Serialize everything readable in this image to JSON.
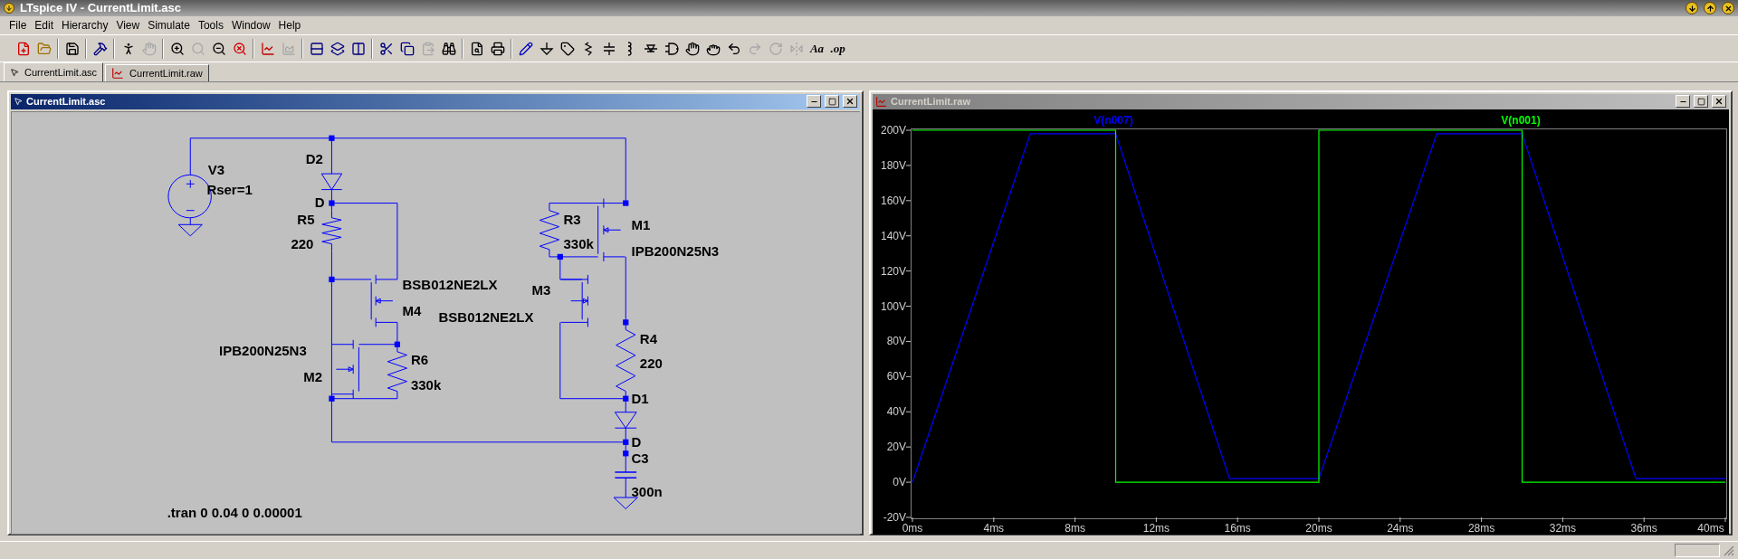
{
  "window": {
    "title": "LTspice IV - CurrentLimit.asc"
  },
  "menu": [
    "File",
    "Edit",
    "Hierarchy",
    "View",
    "Simulate",
    "Tools",
    "Window",
    "Help"
  ],
  "toolbar": [
    {
      "kind": "icon",
      "disabled": false
    },
    {
      "kind": "icon",
      "disabled": false
    },
    {
      "kind": "icon",
      "disabled": false
    },
    {
      "kind": "icon",
      "disabled": false
    },
    {
      "kind": "icon",
      "disabled": false
    },
    {
      "kind": "icon",
      "disabled": true
    },
    {
      "kind": "icon",
      "disabled": false
    },
    {
      "kind": "icon",
      "disabled": true
    },
    {
      "kind": "icon",
      "disabled": false
    },
    {
      "kind": "icon",
      "disabled": false
    },
    {
      "kind": "icon",
      "disabled": false
    },
    {
      "kind": "icon",
      "disabled": true
    },
    {
      "kind": "icon",
      "disabled": false
    },
    {
      "kind": "icon",
      "disabled": false
    },
    {
      "kind": "icon",
      "disabled": false
    },
    {
      "kind": "icon",
      "disabled": false
    },
    {
      "kind": "icon",
      "disabled": false
    },
    {
      "kind": "icon",
      "disabled": true
    },
    {
      "kind": "icon",
      "disabled": false
    },
    {
      "kind": "icon",
      "disabled": false
    },
    {
      "kind": "icon",
      "disabled": false
    },
    {
      "kind": "icon",
      "disabled": false
    },
    {
      "kind": "icon",
      "disabled": false
    },
    {
      "kind": "icon",
      "disabled": false
    },
    {
      "kind": "icon",
      "disabled": false
    },
    {
      "kind": "icon",
      "disabled": false
    },
    {
      "kind": "icon",
      "disabled": false
    },
    {
      "kind": "icon",
      "disabled": false
    },
    {
      "kind": "icon",
      "disabled": false
    },
    {
      "kind": "icon",
      "disabled": false
    },
    {
      "kind": "icon",
      "disabled": false
    },
    {
      "kind": "icon",
      "disabled": false
    },
    {
      "kind": "icon",
      "disabled": true
    },
    {
      "kind": "icon",
      "disabled": true
    },
    {
      "kind": "icon",
      "disabled": true
    },
    {
      "kind": "text",
      "label": "Aa",
      "disabled": false
    },
    {
      "kind": "text",
      "label": ".op",
      "disabled": false
    }
  ],
  "tabs": [
    {
      "label": "CurrentLimit.asc",
      "kind": "schematic",
      "selected": true
    },
    {
      "label": "CurrentLimit.raw",
      "kind": "waveform",
      "selected": false
    }
  ],
  "schematic_window": {
    "title": "CurrentLimit.asc",
    "active": true,
    "labels": [
      "V3",
      "Rser=1",
      "D2",
      "D",
      "R5",
      "220",
      "BSB012NE2LX",
      "M4",
      "IPB200N25N3",
      "M2",
      "R6",
      "330k",
      "R3",
      "330k",
      "M1",
      "IPB200N25N3",
      "M3",
      "BSB012NE2LX",
      "R4",
      "220",
      "D1",
      "D",
      "C3",
      "300n"
    ],
    "directive": ".tran 0 0.04 0 0.00001"
  },
  "plot_window": {
    "title": "CurrentLimit.raw",
    "active": false,
    "chart_data": {
      "type": "line",
      "x": [
        0,
        0,
        5.8,
        10,
        10,
        15.6,
        20,
        20,
        25.8,
        30,
        30,
        35.6,
        40
      ],
      "series": [
        {
          "name": "V(n007)",
          "color": "#0000ff",
          "values": [
            0,
            0,
            198,
            198,
            198,
            2,
            2,
            2,
            198,
            198,
            198,
            2,
            2
          ]
        },
        {
          "name": "V(n001)",
          "color": "#00ff00",
          "values": [
            null,
            200,
            null,
            200,
            0,
            0,
            0,
            200,
            null,
            200,
            0,
            0,
            0
          ]
        }
      ],
      "xlim": [
        0,
        40
      ],
      "ylim": [
        -20,
        200
      ],
      "xticks": [
        {
          "value": 0,
          "label": "0ms"
        },
        {
          "value": 4,
          "label": "4ms"
        },
        {
          "value": 8,
          "label": "8ms"
        },
        {
          "value": 12,
          "label": "12ms"
        },
        {
          "value": 16,
          "label": "16ms"
        },
        {
          "value": 20,
          "label": "20ms"
        },
        {
          "value": 24,
          "label": "24ms"
        },
        {
          "value": 28,
          "label": "28ms"
        },
        {
          "value": 32,
          "label": "32ms"
        },
        {
          "value": 36,
          "label": "36ms"
        },
        {
          "value": 40,
          "label": "40ms"
        }
      ],
      "yticks": [
        {
          "value": 200,
          "label": "200V"
        },
        {
          "value": 180,
          "label": "180V"
        },
        {
          "value": 160,
          "label": "160V"
        },
        {
          "value": 140,
          "label": "140V"
        },
        {
          "value": 120,
          "label": "120V"
        },
        {
          "value": 100,
          "label": "100V"
        },
        {
          "value": 80,
          "label": "80V"
        },
        {
          "value": 60,
          "label": "60V"
        },
        {
          "value": 40,
          "label": "40V"
        },
        {
          "value": 20,
          "label": "20V"
        },
        {
          "value": 0,
          "label": "0V"
        },
        {
          "value": -20,
          "label": "-20V"
        }
      ]
    }
  }
}
